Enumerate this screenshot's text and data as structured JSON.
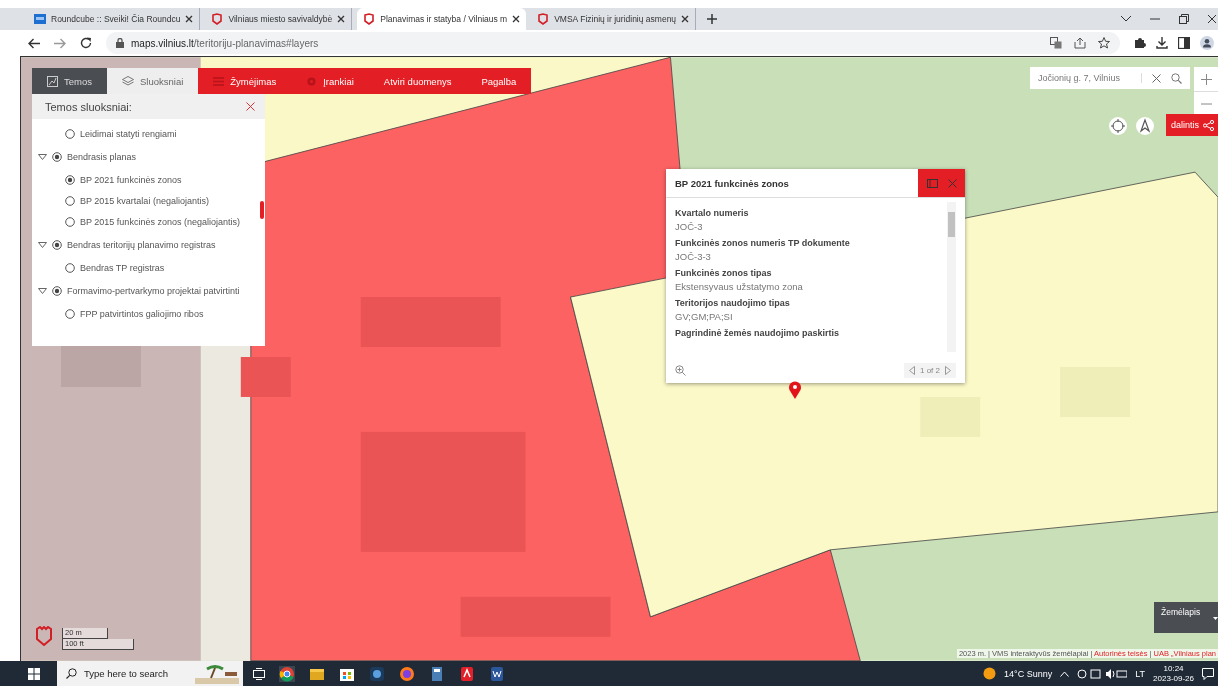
{
  "browser": {
    "tabs": [
      {
        "title": "Roundcube :: Sveiki! Čia Roundcu",
        "kind": "mail",
        "selected": false
      },
      {
        "title": "Vilniaus miesto savivaldybė",
        "kind": "city",
        "selected": false
      },
      {
        "title": "Planavimas ir statyba / Vilniaus m",
        "kind": "city",
        "selected": true
      },
      {
        "title": "VMSA Fizinių ir juridinių asmenų",
        "kind": "city",
        "selected": false
      }
    ],
    "url": "maps.vilnius.lt/teritoriju-planavimas#layers"
  },
  "menu": [
    {
      "label": "Temos",
      "kind": "panel",
      "selected": false
    },
    {
      "label": "Sluoksniai",
      "kind": "panel",
      "selected": true
    },
    {
      "label": "Žymėjimas",
      "kind": "action"
    },
    {
      "label": "Įrankiai",
      "kind": "action"
    },
    {
      "label": "Atviri duomenys",
      "kind": "action"
    },
    {
      "label": "Pagalba",
      "kind": "action"
    }
  ],
  "layers_panel": {
    "title": "Temos sluoksniai:",
    "items": [
      {
        "label": "Leidimai statyti rengiami",
        "selected": false
      },
      {
        "label": "Bendrasis planas",
        "expanded": true,
        "selected": true,
        "children": [
          {
            "label": "BP 2021 funkcinės zonos",
            "selected": true
          },
          {
            "label": "BP 2015 kvartalai (negaliojantis)",
            "selected": false
          },
          {
            "label": "BP 2015 funkcinės zonos (negaliojantis)",
            "selected": false
          }
        ]
      },
      {
        "label": "Bendras teritorijų planavimo registras",
        "expanded": true,
        "selected": true,
        "children": [
          {
            "label": "Bendras TP registras",
            "selected": false
          }
        ]
      },
      {
        "label": "Formavimo-pertvarkymo projektai patvirtinti",
        "expanded": true,
        "selected": true,
        "children": [
          {
            "label": "FPP patvirtintos galiojimo ribos",
            "selected": false
          }
        ]
      }
    ]
  },
  "search": {
    "value": "Jočionių g. 7, Vilnius"
  },
  "share": "dalintis",
  "popup": {
    "title": "BP 2021 funkcinės zonos",
    "fields": [
      {
        "label": "Kvartalo numeris",
        "value": "JOČ-3"
      },
      {
        "label": "Funkcinės zonos numeris TP dokumente",
        "value": "JOČ-3-3"
      },
      {
        "label": "Funkcinės zonos tipas",
        "value": "Ekstensyvaus užstatymo zona"
      },
      {
        "label": "Teritorijos naudojimo tipas",
        "value": "GV;GM;PA;SI"
      },
      {
        "label": "Pagrindinė žemės naudojimo paskirtis"
      }
    ],
    "pager": "1 of 2"
  },
  "scale": [
    "20 m",
    "100 ft"
  ],
  "basemap": "Žemėlapis",
  "attribution": [
    {
      "text": "2023 m. | VMS interaktyvūs žemėlapiai | ",
      "kind": "plain"
    },
    {
      "text": "Autorinės teisės",
      "kind": "link"
    },
    {
      "text": " | ",
      "kind": "plain"
    },
    {
      "text": "UAB „Vilniaus plan",
      "kind": "link"
    }
  ],
  "taskbar": {
    "search_placeholder": "Type here to search",
    "weather": "14°C Sunny",
    "language": "LT",
    "time": "10:24",
    "date": "2023-09-26"
  }
}
